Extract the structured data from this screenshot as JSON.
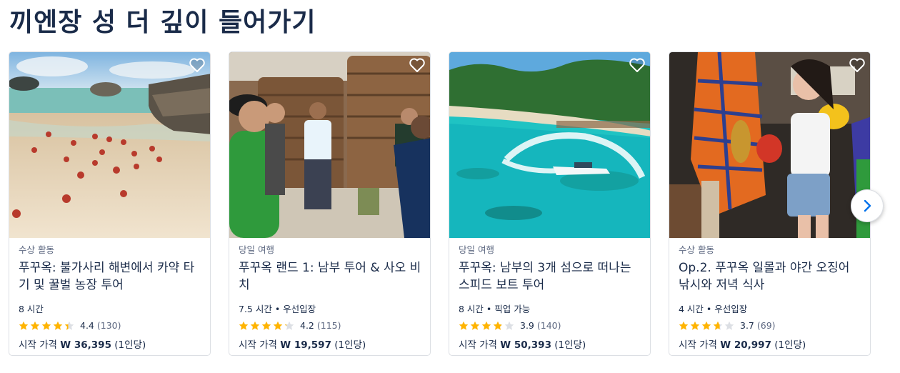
{
  "section": {
    "title": "끼엔장 성 더 깊이 들어가기"
  },
  "colors": {
    "star": "#ffb400",
    "star_empty": "#dcdfe4",
    "heart": "#ffffff",
    "accent": "#0071eb"
  },
  "cards": [
    {
      "category": "수상 활동",
      "title": "푸꾸옥: 불가사리 해변에서 카약 타기 및 꿀벌 농장 투어",
      "meta": "8 시간",
      "rating": "4.4",
      "reviews": "(130)",
      "stars": 4.4,
      "price_prefix": "시작 가격",
      "price": "W 36,395",
      "price_suffix": "(1인당)",
      "photo_icon": "starfish-beach-photo"
    },
    {
      "category": "당일 여행",
      "title": "푸꾸옥 랜드 1: 남부 투어 & 사오 비치",
      "meta": "7.5 시간 • 우선입장",
      "rating": "4.2",
      "reviews": "(115)",
      "stars": 4.2,
      "price_prefix": "시작 가격",
      "price": "W 19,597",
      "price_suffix": "(1인당)",
      "photo_icon": "fish-sauce-factory-photo"
    },
    {
      "category": "당일 여행",
      "title": "푸꾸옥: 남부의 3개 섬으로 떠나는 스피드 보트 투어",
      "meta": "8 시간 • 픽업 가능",
      "rating": "3.9",
      "reviews": "(140)",
      "stars": 3.9,
      "price_prefix": "시작 가격",
      "price": "W 50,393",
      "price_suffix": "(1인당)",
      "photo_icon": "speedboat-island-photo"
    },
    {
      "category": "수상 활동",
      "title": "Op.2. 푸꾸옥 일몰과 야간 오징어 낚시와 저녁 식사",
      "meta": "4 시간 • 우선입장",
      "rating": "3.7",
      "reviews": "(69)",
      "stars": 3.7,
      "price_prefix": "시작 가격",
      "price": "W 20,997",
      "price_suffix": "(1인당)",
      "photo_icon": "squid-fishing-photo"
    }
  ]
}
